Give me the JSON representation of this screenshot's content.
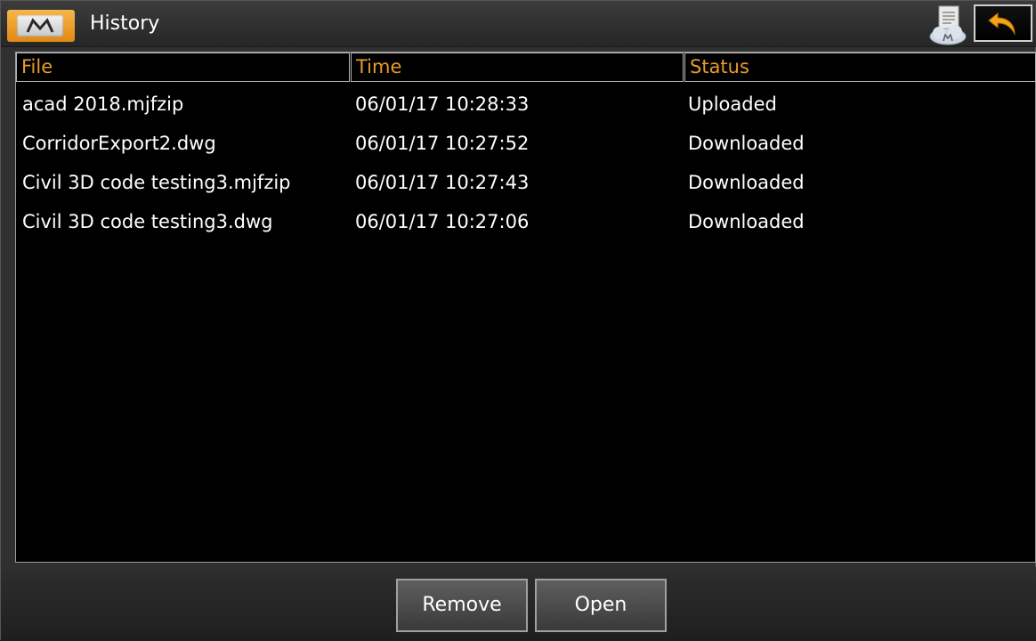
{
  "titlebar": {
    "title": "History",
    "menu_icon": "m-logo-icon",
    "cloud_icon": "cloud-document-icon",
    "back_icon": "back-arrow-icon",
    "accent_color": "#e8951f"
  },
  "table": {
    "columns": [
      "File",
      "Time",
      "Status"
    ],
    "header_color": "#e89a2a",
    "rows": [
      {
        "file": "acad 2018.mjfzip",
        "time": "06/01/17 10:28:33",
        "status": "Uploaded"
      },
      {
        "file": "CorridorExport2.dwg",
        "time": "06/01/17 10:27:52",
        "status": "Downloaded"
      },
      {
        "file": "Civil 3D code testing3.mjfzip",
        "time": "06/01/17 10:27:43",
        "status": "Downloaded"
      },
      {
        "file": "Civil 3D code testing3.dwg",
        "time": "06/01/17 10:27:06",
        "status": "Downloaded"
      }
    ]
  },
  "actions": {
    "remove_label": "Remove",
    "open_label": "Open"
  }
}
